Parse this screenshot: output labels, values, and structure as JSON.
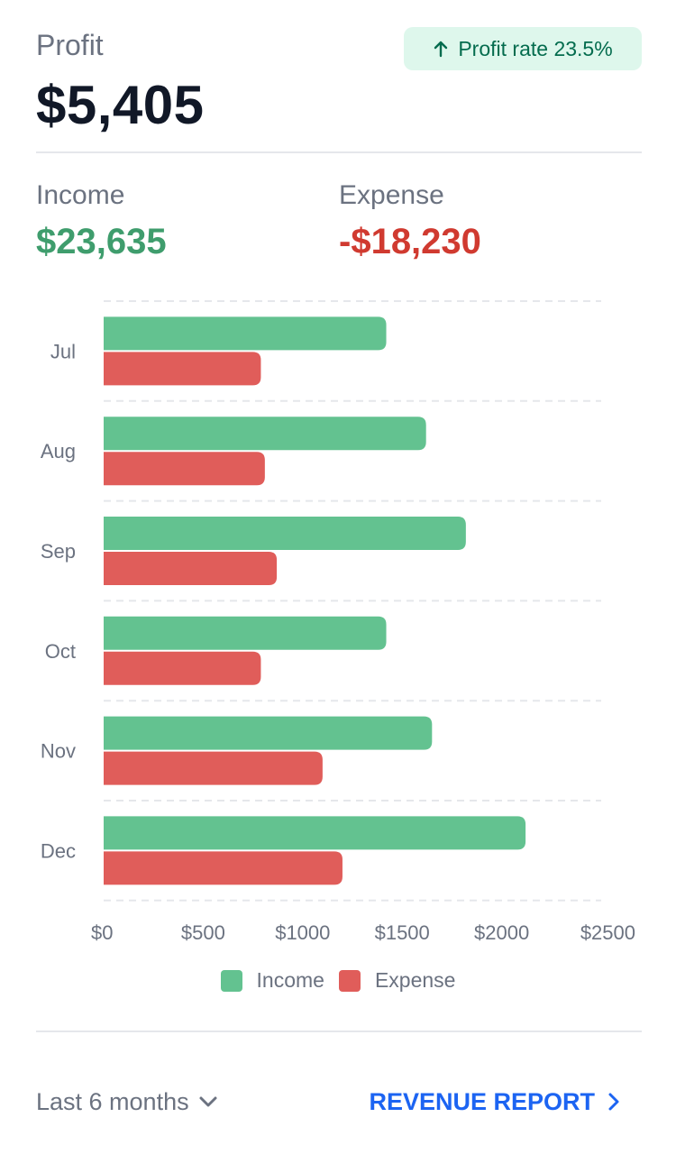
{
  "header": {
    "title": "Profit",
    "value": "$5,405",
    "badge_text": "Profit rate 23.5%",
    "badge_icon": "arrow-up-icon"
  },
  "summary": {
    "income_label": "Income",
    "income_value": "$23,635",
    "expense_label": "Expense",
    "expense_value": "-$18,230"
  },
  "chart_data": {
    "type": "bar",
    "orientation": "horizontal",
    "categories": [
      "Jul",
      "Aug",
      "Sep",
      "Oct",
      "Nov",
      "Dec"
    ],
    "series": [
      {
        "name": "Income",
        "color": "#63c290",
        "values": [
          1420,
          1620,
          1820,
          1420,
          1650,
          2120
        ]
      },
      {
        "name": "Expense",
        "color": "#e05d5a",
        "values": [
          790,
          810,
          870,
          790,
          1100,
          1200
        ]
      }
    ],
    "xlim": [
      0,
      2500
    ],
    "xticks": [
      "$0",
      "$500",
      "$1000",
      "$1500",
      "$2000",
      "$2500"
    ],
    "grid": "horizontal-dashed",
    "legend_position": "bottom"
  },
  "footer": {
    "range_label": "Last 6 months",
    "report_label": "REVENUE REPORT"
  },
  "colors": {
    "income": "#3f9d6d",
    "expense": "#d03a30",
    "accent": "#1c64f2",
    "badge_bg": "#def7ec",
    "badge_text": "#046c4e"
  }
}
